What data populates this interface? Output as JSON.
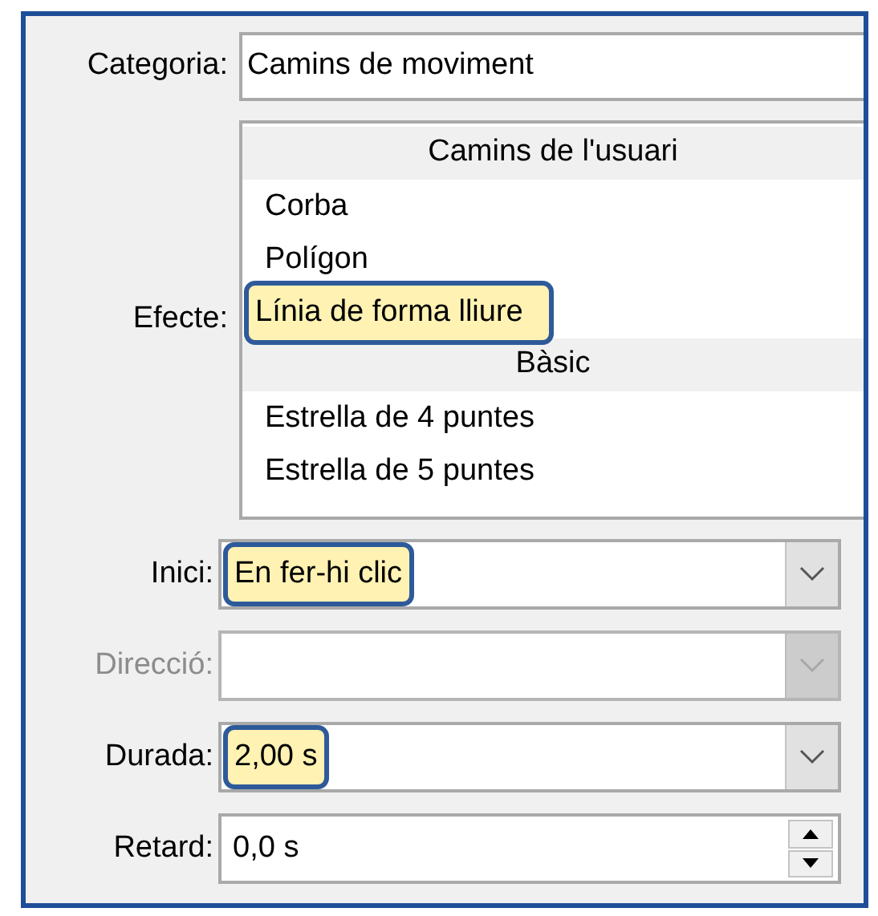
{
  "category": {
    "label": "Categoria:",
    "value": "Camins de moviment"
  },
  "effect": {
    "label": "Efecte:",
    "items": [
      {
        "kind": "header",
        "text": "Camins de l'usuari",
        "highlighted": false
      },
      {
        "kind": "item",
        "text": "Corba",
        "highlighted": false
      },
      {
        "kind": "item",
        "text": "Polígon",
        "highlighted": false
      },
      {
        "kind": "item",
        "text": "Línia de forma lliure",
        "highlighted": true
      },
      {
        "kind": "header",
        "text": "Bàsic",
        "highlighted": false
      },
      {
        "kind": "item",
        "text": "Estrella de 4 puntes",
        "highlighted": false
      },
      {
        "kind": "item",
        "text": "Estrella de 5 puntes",
        "highlighted": false
      }
    ]
  },
  "fields": [
    {
      "kind": "dropdown",
      "label": "Inici:",
      "value": "En fer-hi clic",
      "disabled": false,
      "highlighted": true
    },
    {
      "kind": "dropdown",
      "label": "Direcció:",
      "disabled": true
    },
    {
      "kind": "dropdown",
      "label": "Durada:",
      "value": "2,00 s",
      "disabled": false,
      "highlighted": true
    },
    {
      "kind": "spinner",
      "label": "Retard:",
      "value": "0,0 s",
      "disabled": false,
      "highlighted": false
    }
  ]
}
